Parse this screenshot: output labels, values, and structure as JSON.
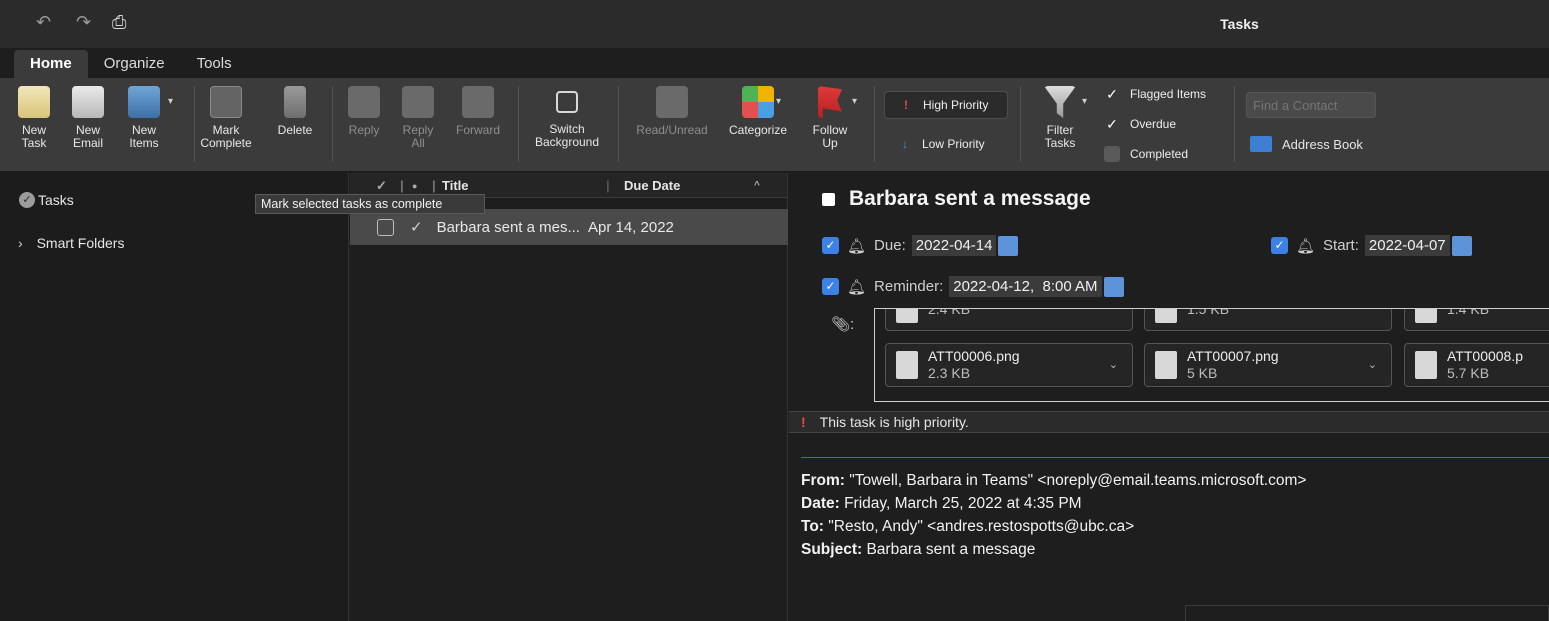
{
  "window": {
    "title": "Tasks"
  },
  "quick_access": {
    "undo_icon": "undo-icon",
    "redo_icon": "redo-icon",
    "print_icon": "print-icon"
  },
  "tabs": [
    {
      "label": "Home",
      "active": true
    },
    {
      "label": "Organize"
    },
    {
      "label": "Tools"
    }
  ],
  "ribbon": {
    "new_task": "New\nTask",
    "new_email": "New\nEmail",
    "new_items": "New\nItems",
    "mark_complete": "Mark\nComplete",
    "delete": "Delete",
    "reply": "Reply",
    "reply_all": "Reply\nAll",
    "forward": "Forward",
    "switch_background": "Switch\nBackground",
    "read_unread": "Read/Unread",
    "categorize": "Categorize",
    "follow_up": "Follow\nUp",
    "high_priority": "High Priority",
    "low_priority": "Low Priority",
    "filter_tasks": "Filter\nTasks",
    "flagged_items": "Flagged Items",
    "overdue": "Overdue",
    "completed": "Completed",
    "find_contact_placeholder": "Find a Contact",
    "address_book": "Address Book"
  },
  "sidebar": {
    "tasks": "Tasks",
    "smart_folders": "Smart Folders",
    "tooltip": "Mark selected tasks as complete"
  },
  "task_list": {
    "columns": {
      "title": "Title",
      "due_date": "Due Date"
    },
    "rows": [
      {
        "title": "Barbara sent a mes...",
        "due": "Apr 14, 2022"
      }
    ]
  },
  "reading_pane": {
    "title": "Barbara sent a message",
    "due_label": "Due:",
    "due_value": "2022-04-14",
    "start_label": "Start:",
    "start_value": "2022-04-07",
    "reminder_label": "Reminder:",
    "reminder_value": "2022-04-12,  8:00 AM",
    "attachments_top": [
      {
        "size": "2.4 KB"
      },
      {
        "size": "1.5 KB"
      },
      {
        "size": "1.4 KB"
      }
    ],
    "attachments": [
      {
        "name": "ATT00006.png",
        "size": "2.3 KB"
      },
      {
        "name": "ATT00007.png",
        "size": "5 KB"
      },
      {
        "name": "ATT00008.p",
        "size": "5.7 KB"
      }
    ],
    "priority_banner": "This task is high priority.",
    "from_label": "From:",
    "from_value": " \"Towell, Barbara in Teams\" <noreply@email.teams.microsoft.com>",
    "date_label": "Date:",
    "date_value": " Friday, March 25, 2022 at 4:35 PM",
    "to_label": "To:",
    "to_value": " \"Resto, Andy\" <andres.restospotts@ubc.ca>",
    "subject_label": "Subject:",
    "subject_value": " Barbara sent a message"
  }
}
